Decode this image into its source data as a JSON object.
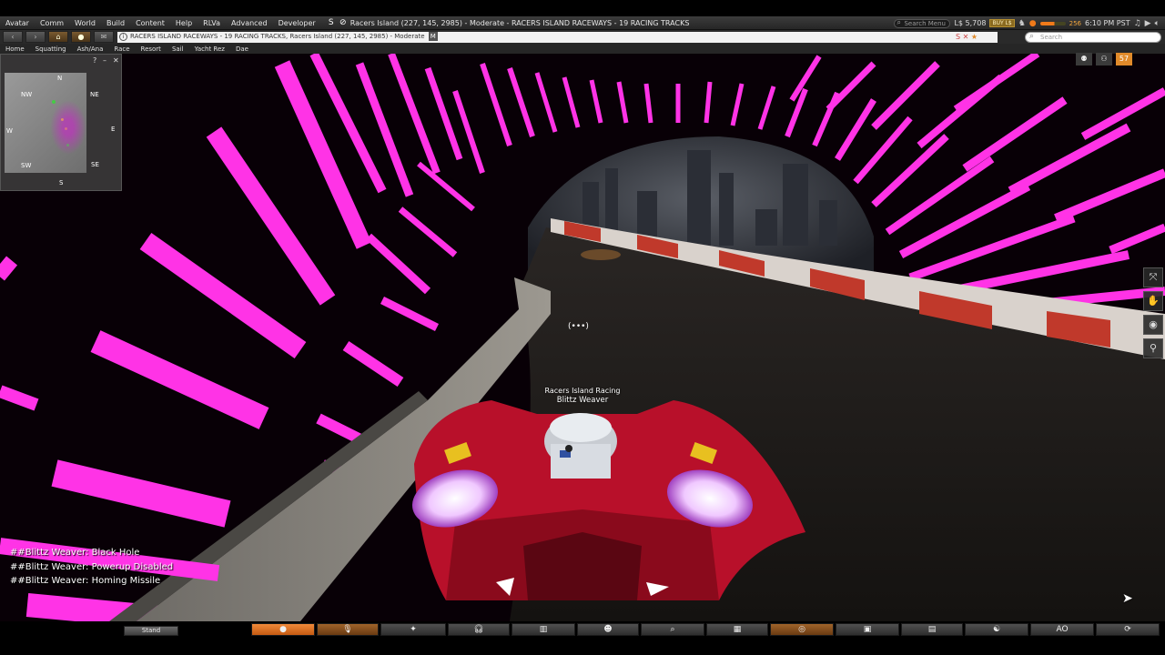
{
  "menubar": {
    "items": [
      "Avatar",
      "Comm",
      "World",
      "Build",
      "Content",
      "Help",
      "RLVa",
      "Advanced",
      "Developer"
    ],
    "region_title": "Racers Island (227, 145, 2985) - Moderate - RACERS ISLAND RACEWAYS - 19 RACING TRACKS",
    "search_menu_placeholder": "Search Menu",
    "balance": "L$ 5,708",
    "buy_label": "BUY L$",
    "fps_value": "256",
    "time": "6:10 PM PST"
  },
  "navbar": {
    "location": "RACERS ISLAND RACEWAYS - 19 RACING TRACKS, Racers Island (227, 145, 2985) - Moderate",
    "maturity_badge": "M",
    "search_placeholder": "Search"
  },
  "favorites": [
    "Home",
    "Squatting",
    "Ash/Ana",
    "Race",
    "Resort",
    "Sail",
    "Yacht Rez",
    "Dae"
  ],
  "minimap": {
    "directions": {
      "n": "N",
      "ne": "NE",
      "nw": "NW",
      "e": "E",
      "w": "W",
      "sw": "SW",
      "se": "SE",
      "s": "S"
    },
    "help": "?",
    "minimize": "–",
    "close": "✕"
  },
  "top_right": {
    "count_badge": "57"
  },
  "nametag": {
    "group": "Racers Island Racing",
    "name": "Blittz Weaver"
  },
  "voice_indicator": "(•••)",
  "chat": [
    "##Blittz Weaver: Black Hole",
    "##Blittz Weaver: Powerup Disabled",
    "##Blittz Weaver: Homing Missile"
  ],
  "bottom": {
    "stand_label": "Stand",
    "ao_label": "AO"
  },
  "icons": {
    "chat": "chat-bubble-icon",
    "voice": "microphone-icon",
    "gesture": "gesture-icon",
    "speak": "headset-icon",
    "destinations": "book-icon",
    "people": "people-icon",
    "search": "search-icon",
    "map": "map-icon",
    "minimap": "radar-icon",
    "snapshot": "camera-icon",
    "inventory": "inventory-icon",
    "avatar": "avatar-icon",
    "settings": "settings-icon"
  },
  "colors": {
    "tunnel_neon": "#ff33e6",
    "car_red": "#c8102e",
    "toolbar_orange": "#e8752a"
  }
}
